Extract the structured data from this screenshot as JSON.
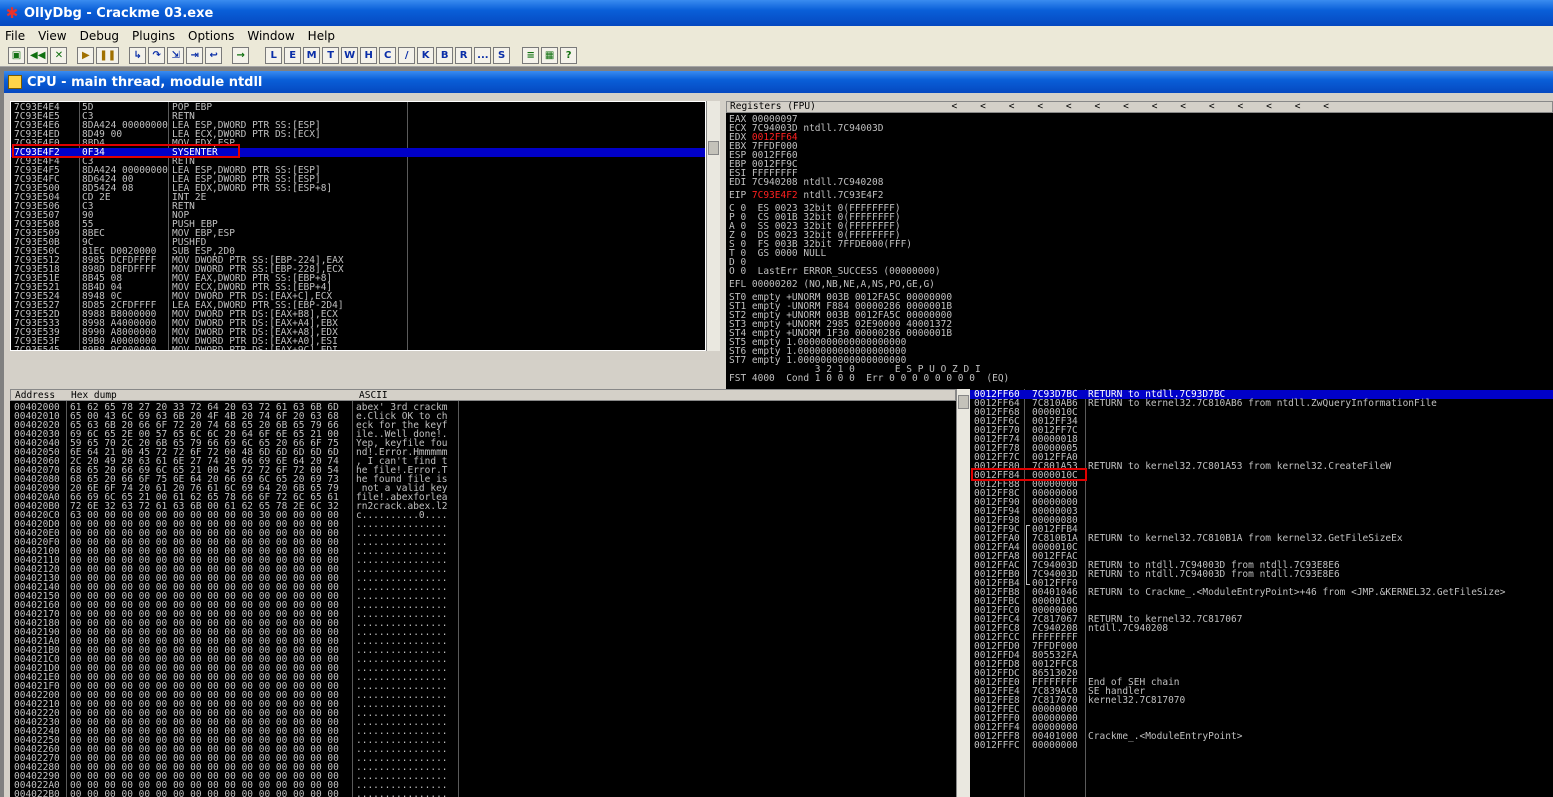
{
  "window": {
    "title": "OllyDbg - Crackme 03.exe"
  },
  "menu": [
    "File",
    "View",
    "Debug",
    "Plugins",
    "Options",
    "Window",
    "Help"
  ],
  "toolbar": {
    "icon_buttons": [
      "open-icon",
      "rewind-icon",
      "close-icon",
      "run-icon",
      "pause-icon",
      "step-into-icon",
      "step-over-icon",
      "trace-into-icon",
      "trace-over-icon",
      "execute-till-return-icon",
      "goto-icon"
    ],
    "letter_buttons": [
      "L",
      "E",
      "M",
      "T",
      "W",
      "H",
      "C",
      "/",
      "K",
      "B",
      "R",
      "...",
      "S"
    ],
    "tail_icons": [
      "list-icon",
      "grid-icon",
      "help-icon"
    ]
  },
  "cpu_window": {
    "title": "CPU - main thread, module ntdll"
  },
  "disasm": {
    "rows": [
      [
        "7C93E4E4",
        "5D",
        "POP EBP"
      ],
      [
        "7C93E4E5",
        "C3",
        "RETN"
      ],
      [
        "7C93E4E6",
        "8DA424 00000000",
        "LEA ESP,DWORD PTR SS:[ESP]"
      ],
      [
        "7C93E4ED",
        "8D49 00",
        "LEA ECX,DWORD PTR DS:[ECX]"
      ],
      [
        "7C93E4F0",
        "8BD4",
        "MOV EDX,ESP"
      ],
      [
        "7C93E4F2",
        "0F34",
        "SYSENTER"
      ],
      [
        "7C93E4F4",
        "C3",
        "RETN"
      ],
      [
        "7C93E4F5",
        "8DA424 00000000",
        "LEA ESP,DWORD PTR SS:[ESP]"
      ],
      [
        "7C93E4FC",
        "8D6424 00",
        "LEA ESP,DWORD PTR SS:[ESP]"
      ],
      [
        "7C93E500",
        "8D5424 08",
        "LEA EDX,DWORD PTR SS:[ESP+8]"
      ],
      [
        "7C93E504",
        "CD 2E",
        "INT 2E"
      ],
      [
        "7C93E506",
        "C3",
        "RETN"
      ],
      [
        "7C93E507",
        "90",
        "NOP"
      ],
      [
        "7C93E508",
        "55",
        "PUSH EBP"
      ],
      [
        "7C93E509",
        "8BEC",
        "MOV EBP,ESP"
      ],
      [
        "7C93E50B",
        "9C",
        "PUSHFD"
      ],
      [
        "7C93E50C",
        "81EC D0020000",
        "SUB ESP,2D0"
      ],
      [
        "7C93E512",
        "8985 DCFDFFFF",
        "MOV DWORD PTR SS:[EBP-224],EAX"
      ],
      [
        "7C93E518",
        "898D D8FDFFFF",
        "MOV DWORD PTR SS:[EBP-228],ECX"
      ],
      [
        "7C93E51E",
        "8B45 08",
        "MOV EAX,DWORD PTR SS:[EBP+8]"
      ],
      [
        "7C93E521",
        "8B4D 04",
        "MOV ECX,DWORD PTR SS:[EBP+4]"
      ],
      [
        "7C93E524",
        "8948 0C",
        "MOV DWORD PTR DS:[EAX+C],ECX"
      ],
      [
        "7C93E527",
        "8D85 2CFDFFFF",
        "LEA EAX,DWORD PTR SS:[EBP-2D4]"
      ],
      [
        "7C93E52D",
        "8988 B8000000",
        "MOV DWORD PTR DS:[EAX+B8],ECX"
      ],
      [
        "7C93E533",
        "8998 A4000000",
        "MOV DWORD PTR DS:[EAX+A4],EBX"
      ],
      [
        "7C93E539",
        "8990 A8000000",
        "MOV DWORD PTR DS:[EAX+A8],EDX"
      ],
      [
        "7C93E53F",
        "89B0 A0000000",
        "MOV DWORD PTR DS:[EAX+A0],ESI"
      ],
      [
        "7C93E545",
        "89B8 9C000000",
        "MOV DWORD PTR DS:[EAX+9C],EDI"
      ]
    ],
    "selected_index": 5
  },
  "registers": {
    "header": "Registers (FPU)",
    "header_arrows": "<    <    <    <    <    <    <    <    <    <    <    <    <    <",
    "lines": [
      "EAX 00000097",
      "ECX 7C94003D ntdll.7C94003D",
      "EDX 0012FF64",
      "EBX 7FFDF000",
      "ESP 0012FF60",
      "EBP 0012FF9C",
      "ESI FFFFFFFF",
      "EDI 7C940208 ntdll.7C940208",
      "",
      "EIP 7C93E4F2 ntdll.7C93E4F2",
      "",
      "C 0  ES 0023 32bit 0(FFFFFFFF)",
      "P 0  CS 001B 32bit 0(FFFFFFFF)",
      "A 0  SS 0023 32bit 0(FFFFFFFF)",
      "Z 0  DS 0023 32bit 0(FFFFFFFF)",
      "S 0  FS 003B 32bit 7FFDE000(FFF)",
      "T 0  GS 0000 NULL",
      "D 0",
      "O 0  LastErr ERROR_SUCCESS (00000000)",
      "",
      "EFL 00000202 (NO,NB,NE,A,NS,PO,GE,G)",
      "",
      "ST0 empty +UNORM 003B 0012FA5C 00000000",
      "ST1 empty -UNORM F884 00000286 0000001B",
      "ST2 empty +UNORM 003B 0012FA5C 00000000",
      "ST3 empty +UNORM 2985 02E90000 40001372",
      "ST4 empty +UNORM 1F30 00000286 0000001B",
      "ST5 empty 1.0000000000000000000",
      "ST6 empty 1.0000000000000000000",
      "ST7 empty 1.0000000000000000000",
      "               3 2 1 0       E S P U O Z D I",
      "FST 4000  Cond 1 0 0 0  Err 0 0 0 0 0 0 0 0  (EQ)"
    ],
    "red_values": {
      "EDX": "0012FF64",
      "EIP": "7C93E4F2"
    }
  },
  "dump": {
    "col_address": "Address",
    "col_hex": "Hex dump",
    "col_ascii": "ASCII",
    "rows": [
      [
        "00402000",
        "61 62 65 78 27 20 33 72 64 20 63 72 61 63 6B 6D",
        "abex' 3rd crackm"
      ],
      [
        "00402010",
        "65 00 43 6C 69 63 6B 20 4F 4B 20 74 6F 20 63 68",
        "e.Click OK to ch"
      ],
      [
        "00402020",
        "65 63 6B 20 66 6F 72 20 74 68 65 20 6B 65 79 66",
        "eck for the keyf"
      ],
      [
        "00402030",
        "69 6C 65 2E 00 57 65 6C 6C 20 64 6F 6E 65 21 00",
        "ile..Well done!."
      ],
      [
        "00402040",
        "59 65 70 2C 20 6B 65 79 66 69 6C 65 20 66 6F 75",
        "Yep, keyfile fou"
      ],
      [
        "00402050",
        "6E 64 21 00 45 72 72 6F 72 00 48 6D 6D 6D 6D 6D",
        "nd!.Error.Hmmmmm"
      ],
      [
        "00402060",
        "2C 20 49 20 63 61 6E 27 74 20 66 69 6E 64 20 74",
        ", I can't find t"
      ],
      [
        "00402070",
        "68 65 20 66 69 6C 65 21 00 45 72 72 6F 72 00 54",
        "he file!.Error.T"
      ],
      [
        "00402080",
        "68 65 20 66 6F 75 6E 64 20 66 69 6C 65 20 69 73",
        "he found file is"
      ],
      [
        "00402090",
        "20 6E 6F 74 20 61 20 76 61 6C 69 64 20 6B 65 79",
        " not a valid key"
      ],
      [
        "004020A0",
        "66 69 6C 65 21 00 61 62 65 78 66 6F 72 6C 65 61",
        "file!.abexforlea"
      ],
      [
        "004020B0",
        "72 6E 32 63 72 61 63 6B 00 61 62 65 78 2E 6C 32",
        "rn2crack.abex.l2"
      ],
      [
        "004020C0",
        "63 00 00 00 00 00 00 00 00 00 00 30 00 00 00 00",
        "c..........0...."
      ],
      [
        "004020D0",
        "00 00 00 00 00 00 00 00 00 00 00 00 00 00 00 00",
        "................"
      ],
      [
        "004020E0",
        "00 00 00 00 00 00 00 00 00 00 00 00 00 00 00 00",
        "................"
      ],
      [
        "004020F0",
        "00 00 00 00 00 00 00 00 00 00 00 00 00 00 00 00",
        "................"
      ],
      [
        "00402100",
        "00 00 00 00 00 00 00 00 00 00 00 00 00 00 00 00",
        "................"
      ],
      [
        "00402110",
        "00 00 00 00 00 00 00 00 00 00 00 00 00 00 00 00",
        "................"
      ],
      [
        "00402120",
        "00 00 00 00 00 00 00 00 00 00 00 00 00 00 00 00",
        "................"
      ],
      [
        "00402130",
        "00 00 00 00 00 00 00 00 00 00 00 00 00 00 00 00",
        "................"
      ],
      [
        "00402140",
        "00 00 00 00 00 00 00 00 00 00 00 00 00 00 00 00",
        "................"
      ],
      [
        "00402150",
        "00 00 00 00 00 00 00 00 00 00 00 00 00 00 00 00",
        "................"
      ],
      [
        "00402160",
        "00 00 00 00 00 00 00 00 00 00 00 00 00 00 00 00",
        "................"
      ],
      [
        "00402170",
        "00 00 00 00 00 00 00 00 00 00 00 00 00 00 00 00",
        "................"
      ],
      [
        "00402180",
        "00 00 00 00 00 00 00 00 00 00 00 00 00 00 00 00",
        "................"
      ],
      [
        "00402190",
        "00 00 00 00 00 00 00 00 00 00 00 00 00 00 00 00",
        "................"
      ],
      [
        "004021A0",
        "00 00 00 00 00 00 00 00 00 00 00 00 00 00 00 00",
        "................"
      ],
      [
        "004021B0",
        "00 00 00 00 00 00 00 00 00 00 00 00 00 00 00 00",
        "................"
      ],
      [
        "004021C0",
        "00 00 00 00 00 00 00 00 00 00 00 00 00 00 00 00",
        "................"
      ],
      [
        "004021D0",
        "00 00 00 00 00 00 00 00 00 00 00 00 00 00 00 00",
        "................"
      ],
      [
        "004021E0",
        "00 00 00 00 00 00 00 00 00 00 00 00 00 00 00 00",
        "................"
      ],
      [
        "004021F0",
        "00 00 00 00 00 00 00 00 00 00 00 00 00 00 00 00",
        "................"
      ],
      [
        "00402200",
        "00 00 00 00 00 00 00 00 00 00 00 00 00 00 00 00",
        "................"
      ],
      [
        "00402210",
        "00 00 00 00 00 00 00 00 00 00 00 00 00 00 00 00",
        "................"
      ],
      [
        "00402220",
        "00 00 00 00 00 00 00 00 00 00 00 00 00 00 00 00",
        "................"
      ],
      [
        "00402230",
        "00 00 00 00 00 00 00 00 00 00 00 00 00 00 00 00",
        "................"
      ],
      [
        "00402240",
        "00 00 00 00 00 00 00 00 00 00 00 00 00 00 00 00",
        "................"
      ],
      [
        "00402250",
        "00 00 00 00 00 00 00 00 00 00 00 00 00 00 00 00",
        "................"
      ],
      [
        "00402260",
        "00 00 00 00 00 00 00 00 00 00 00 00 00 00 00 00",
        "................"
      ],
      [
        "00402270",
        "00 00 00 00 00 00 00 00 00 00 00 00 00 00 00 00",
        "................"
      ],
      [
        "00402280",
        "00 00 00 00 00 00 00 00 00 00 00 00 00 00 00 00",
        "................"
      ],
      [
        "00402290",
        "00 00 00 00 00 00 00 00 00 00 00 00 00 00 00 00",
        "................"
      ],
      [
        "004022A0",
        "00 00 00 00 00 00 00 00 00 00 00 00 00 00 00 00",
        "................"
      ],
      [
        "004022B0",
        "00 00 00 00 00 00 00 00 00 00 00 00 00 00 00 00",
        "................"
      ]
    ]
  },
  "stack": {
    "rows": [
      [
        "0012FF60",
        "7C93D7BC",
        "RETURN to ntdll.7C93D7BC"
      ],
      [
        "0012FF64",
        "7C810AB6",
        "RETURN to kernel32.7C810AB6 from ntdll.ZwQueryInformationFile"
      ],
      [
        "0012FF68",
        "0000010C",
        ""
      ],
      [
        "0012FF6C",
        "0012FF34",
        ""
      ],
      [
        "0012FF70",
        "0012FF7C",
        ""
      ],
      [
        "0012FF74",
        "00000018",
        ""
      ],
      [
        "0012FF78",
        "00000005",
        ""
      ],
      [
        "0012FF7C",
        "0012FFA0",
        ""
      ],
      [
        "0012FF80",
        "7C801A53",
        "RETURN to kernel32.7C801A53 from kernel32.CreateFileW"
      ],
      [
        "0012FF84",
        "0000010C",
        ""
      ],
      [
        "0012FF88",
        "00000000",
        ""
      ],
      [
        "0012FF8C",
        "00000000",
        ""
      ],
      [
        "0012FF90",
        "00000000",
        ""
      ],
      [
        "0012FF94",
        "00000003",
        ""
      ],
      [
        "0012FF98",
        "00000080",
        ""
      ],
      [
        "0012FF9C",
        "0012FFB4",
        ""
      ],
      [
        "0012FFA0",
        "7C810B1A",
        "RETURN to kernel32.7C810B1A from kernel32.GetFileSizeEx"
      ],
      [
        "0012FFA4",
        "0000010C",
        ""
      ],
      [
        "0012FFA8",
        "0012FFAC",
        ""
      ],
      [
        "0012FFAC",
        "7C94003D",
        "RETURN to ntdll.7C94003D from ntdll.7C93E8E6"
      ],
      [
        "0012FFB0",
        "7C94003D",
        "RETURN to ntdll.7C94003D from ntdll.7C93E8E6"
      ],
      [
        "0012FFB4",
        "0012FFF0",
        ""
      ],
      [
        "0012FFB8",
        "00401046",
        "RETURN to Crackme_.<ModuleEntryPoint>+46 from <JMP.&KERNEL32.GetFileSize>"
      ],
      [
        "0012FFBC",
        "0000010C",
        ""
      ],
      [
        "0012FFC0",
        "00000000",
        ""
      ],
      [
        "0012FFC4",
        "7C817067",
        "RETURN to kernel32.7C817067"
      ],
      [
        "0012FFC8",
        "7C940208",
        "ntdll.7C940208"
      ],
      [
        "0012FFCC",
        "FFFFFFFF",
        ""
      ],
      [
        "0012FFD0",
        "7FFDF000",
        ""
      ],
      [
        "0012FFD4",
        "805532FA",
        ""
      ],
      [
        "0012FFD8",
        "0012FFC8",
        ""
      ],
      [
        "0012FFDC",
        "86513020",
        ""
      ],
      [
        "0012FFE0",
        "FFFFFFFF",
        "End of SEH chain"
      ],
      [
        "0012FFE4",
        "7C839AC0",
        "SE handler"
      ],
      [
        "0012FFE8",
        "7C817070",
        "kernel32.7C817070"
      ],
      [
        "0012FFEC",
        "00000000",
        ""
      ],
      [
        "0012FFF0",
        "00000000",
        ""
      ],
      [
        "0012FFF4",
        "00000000",
        ""
      ],
      [
        "0012FFF8",
        "00401000",
        "Crackme_.<ModuleEntryPoint>"
      ],
      [
        "0012FFFC",
        "00000000",
        ""
      ]
    ],
    "selected_index": 0,
    "boxed_index": 9
  }
}
